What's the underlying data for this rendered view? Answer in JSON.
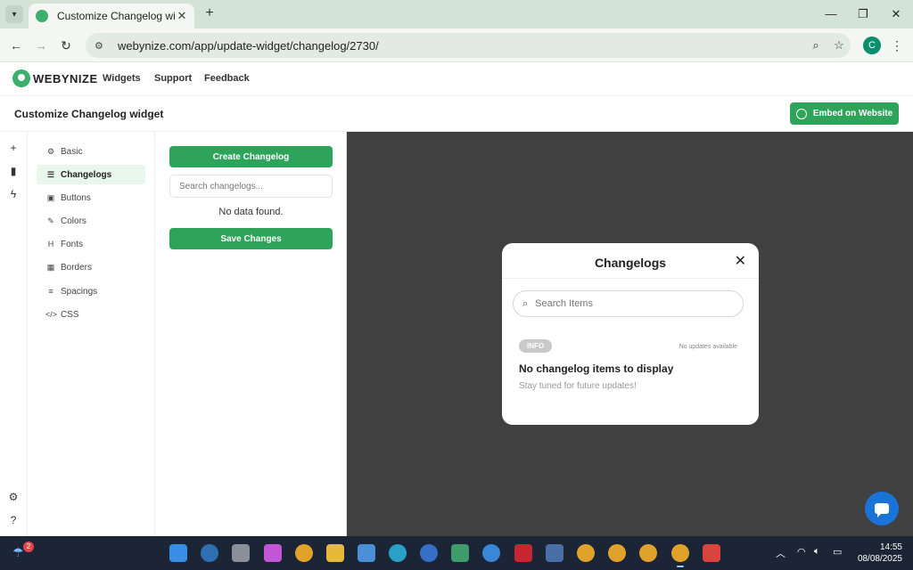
{
  "browser": {
    "tab_title": "Customize Changelog widget",
    "url": "webynize.com/app/update-widget/changelog/2730/",
    "profile_initial": "C"
  },
  "app": {
    "logo_text": "WEBYNIZE",
    "nav": [
      "Widgets",
      "Support",
      "Feedback"
    ],
    "page_title": "Customize Changelog widget",
    "embed_label": "Embed on Website"
  },
  "sidebar": {
    "items": [
      {
        "label": "Basic",
        "icon": "gear-icon"
      },
      {
        "label": "Changelogs",
        "icon": "list-icon"
      },
      {
        "label": "Buttons",
        "icon": "buttons-icon"
      },
      {
        "label": "Colors",
        "icon": "brush-icon"
      },
      {
        "label": "Fonts",
        "icon": "heading-icon"
      },
      {
        "label": "Borders",
        "icon": "table-icon"
      },
      {
        "label": "Spacings",
        "icon": "sliders-icon"
      },
      {
        "label": "CSS",
        "icon": "code-icon"
      }
    ],
    "active": "Changelogs"
  },
  "editor": {
    "create_label": "Create Changelog",
    "search_placeholder": "Search changelogs...",
    "empty_text": "No data found.",
    "save_label": "Save Changes"
  },
  "preview": {
    "modal_title": "Changelogs",
    "search_placeholder": "Search Items",
    "badge": "INFO",
    "no_updates": "No updates available",
    "empty_title": "No changelog items to display",
    "empty_subtitle": "Stay tuned for future updates!"
  },
  "taskbar": {
    "weather_badge": "2",
    "time": "14:55",
    "date": "08/08/2025"
  },
  "colors": {
    "accent": "#2ea35a",
    "preview_bg": "#404040",
    "chat_fab": "#1a73d9"
  }
}
